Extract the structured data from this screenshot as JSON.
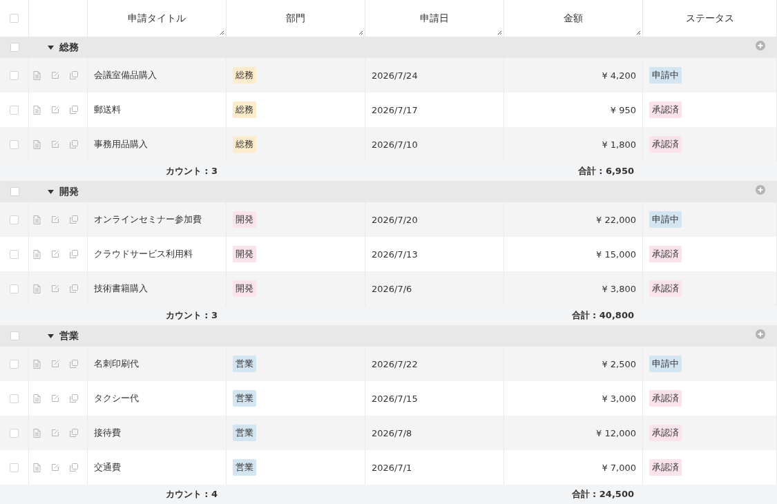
{
  "table": {
    "all_checked": false,
    "columns": [
      "申請タイトル",
      "部門",
      "申請日",
      "金額",
      "ステータス"
    ],
    "groups": [
      {
        "name": "総務",
        "checked": false,
        "expanded": true,
        "count": "カウント : 3",
        "total": "合計 : 6,950",
        "rows": [
          {
            "checked": false,
            "title": "会議室備品購入",
            "dept": {
              "label": "総務",
              "color": "#fdeccb"
            },
            "date": "2026/7/24",
            "amount": "¥ 4,200",
            "status": {
              "label": "申請中",
              "color": "#d4e5f2"
            }
          },
          {
            "checked": false,
            "title": "郵送料",
            "dept": {
              "label": "総務",
              "color": "#fdeccb"
            },
            "date": "2026/7/17",
            "amount": "¥ 950",
            "status": {
              "label": "承認済",
              "color": "#fbe3ea"
            }
          },
          {
            "checked": false,
            "title": "事務用品購入",
            "dept": {
              "label": "総務",
              "color": "#fdeccb"
            },
            "date": "2026/7/10",
            "amount": "¥ 1,800",
            "status": {
              "label": "承認済",
              "color": "#fbe3ea"
            }
          }
        ]
      },
      {
        "name": "開発",
        "checked": false,
        "expanded": true,
        "count": "カウント : 3",
        "total": "合計 : 40,800",
        "rows": [
          {
            "checked": false,
            "title": "オンラインセミナー参加費",
            "dept": {
              "label": "開発",
              "color": "#fbe3ea"
            },
            "date": "2026/7/20",
            "amount": "¥ 22,000",
            "status": {
              "label": "申請中",
              "color": "#d4e5f2"
            }
          },
          {
            "checked": false,
            "title": "クラウドサービス利用料",
            "dept": {
              "label": "開発",
              "color": "#fbe3ea"
            },
            "date": "2026/7/13",
            "amount": "¥ 15,000",
            "status": {
              "label": "承認済",
              "color": "#fbe3ea"
            }
          },
          {
            "checked": false,
            "title": "技術書籍購入",
            "dept": {
              "label": "開発",
              "color": "#fbe3ea"
            },
            "date": "2026/7/6",
            "amount": "¥ 3,800",
            "status": {
              "label": "承認済",
              "color": "#fbe3ea"
            }
          }
        ]
      },
      {
        "name": "営業",
        "checked": false,
        "expanded": true,
        "count": "カウント : 4",
        "total": "合計 : 24,500",
        "rows": [
          {
            "checked": false,
            "title": "名刺印刷代",
            "dept": {
              "label": "営業",
              "color": "#d4e5f2"
            },
            "date": "2026/7/22",
            "amount": "¥ 2,500",
            "status": {
              "label": "申請中",
              "color": "#d4e5f2"
            }
          },
          {
            "checked": false,
            "title": "タクシー代",
            "dept": {
              "label": "営業",
              "color": "#d4e5f2"
            },
            "date": "2026/7/15",
            "amount": "¥ 3,000",
            "status": {
              "label": "承認済",
              "color": "#fbe3ea"
            }
          },
          {
            "checked": false,
            "title": "接待費",
            "dept": {
              "label": "営業",
              "color": "#d4e5f2"
            },
            "date": "2026/7/8",
            "amount": "¥ 12,000",
            "status": {
              "label": "承認済",
              "color": "#fbe3ea"
            }
          },
          {
            "checked": false,
            "title": "交通費",
            "dept": {
              "label": "営業",
              "color": "#d4e5f2"
            },
            "date": "2026/7/1",
            "amount": "¥ 7,000",
            "status": {
              "label": "承認済",
              "color": "#fbe3ea"
            }
          }
        ]
      }
    ]
  }
}
